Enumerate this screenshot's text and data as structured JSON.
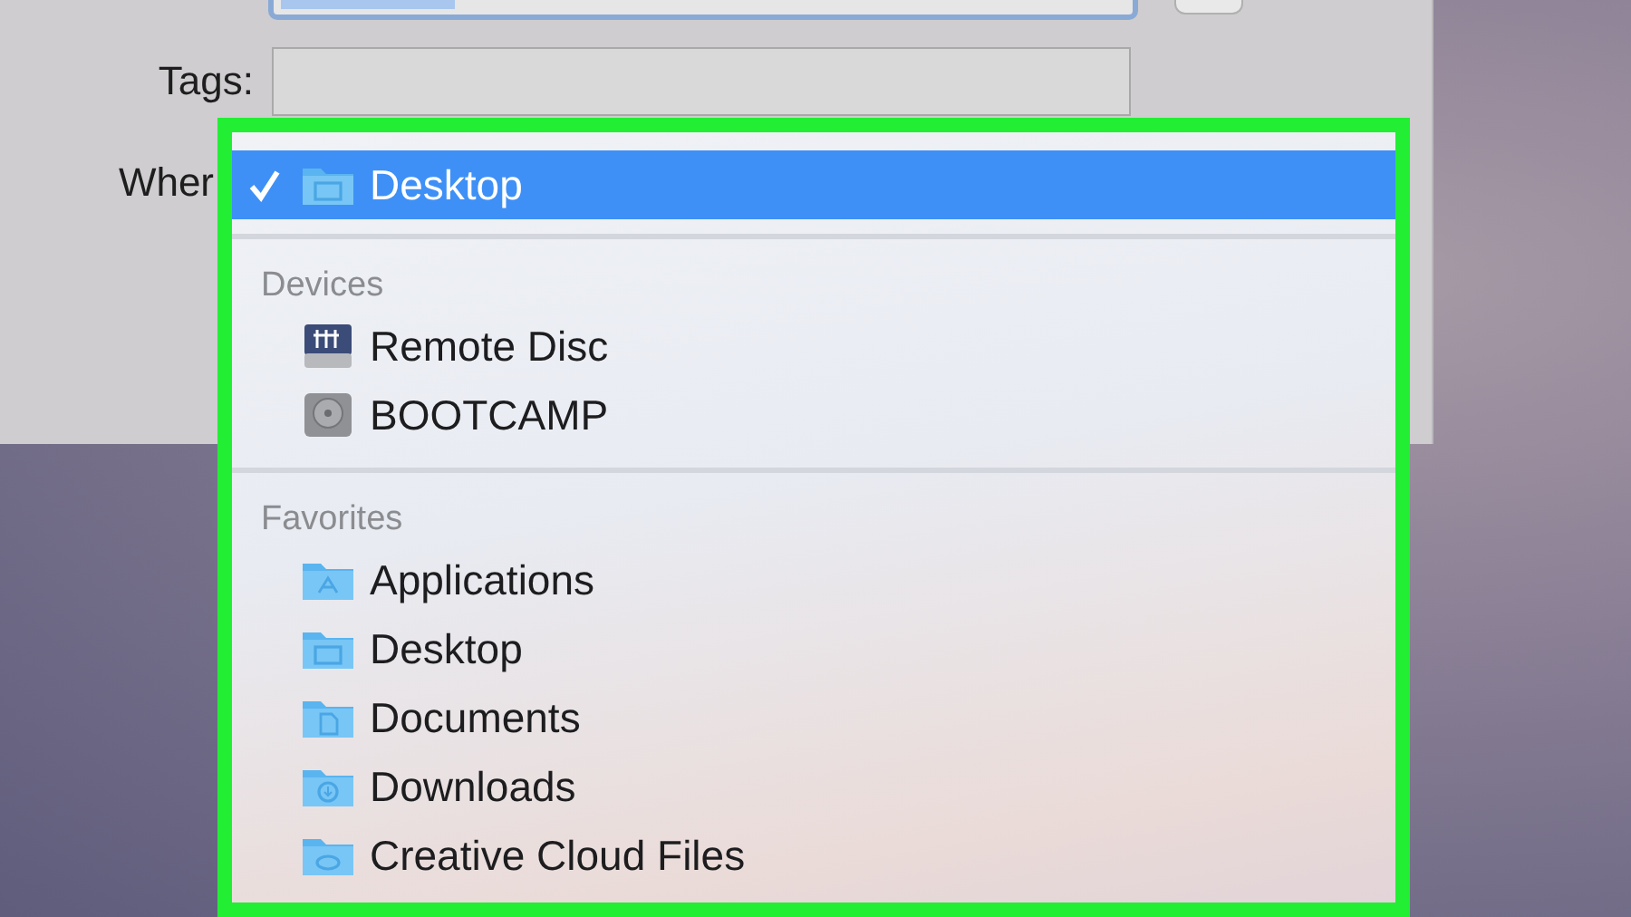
{
  "dialog": {
    "tags_label": "Tags:",
    "where_label": "Wher"
  },
  "menu": {
    "sections": [
      {
        "items": [
          {
            "label": "Desktop",
            "kind": "desktop-folder",
            "selected": true
          }
        ]
      },
      {
        "header": "Devices",
        "items": [
          {
            "label": "Remote Disc",
            "kind": "remote-disc",
            "selected": false
          },
          {
            "label": "BOOTCAMP",
            "kind": "disk",
            "selected": false
          }
        ]
      },
      {
        "header": "Favorites",
        "items": [
          {
            "label": "Applications",
            "kind": "apps-folder",
            "selected": false
          },
          {
            "label": "Desktop",
            "kind": "desktop-folder",
            "selected": false
          },
          {
            "label": "Documents",
            "kind": "documents-folder",
            "selected": false
          },
          {
            "label": "Downloads",
            "kind": "downloads-folder",
            "selected": false
          },
          {
            "label": "Creative Cloud Files",
            "kind": "cloud-folder",
            "selected": false
          }
        ]
      }
    ]
  }
}
